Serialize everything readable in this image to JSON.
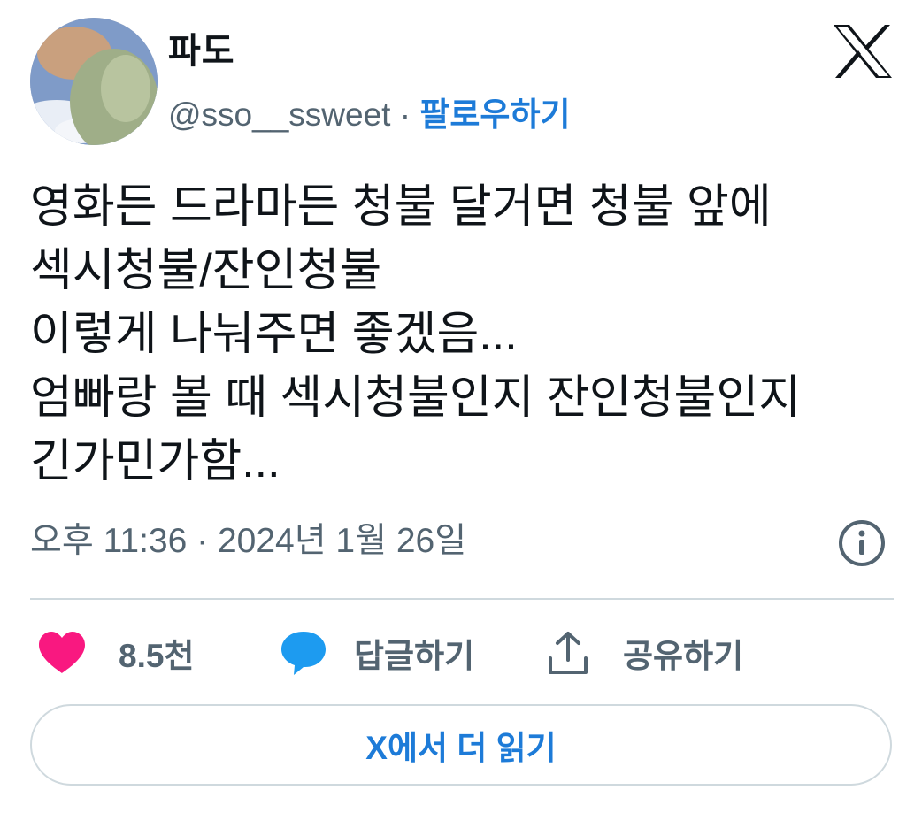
{
  "author": {
    "display_name": "파도",
    "handle": "@sso__ssweet",
    "separator": "·",
    "follow_label": "팔로우하기"
  },
  "tweet": {
    "lines": [
      "영화든 드라마든 청불 달거면 청불 앞에",
      "섹시청불/잔인청불",
      "이렇게 나눠주면 좋겠음...",
      "엄빠랑 볼 때 섹시청불인지 잔인청불인지",
      "긴가민가함..."
    ],
    "timestamp": "오후 11:36 · 2024년 1월 26일"
  },
  "actions": {
    "like_count": "8.5천",
    "reply_label": "답글하기",
    "share_label": "공유하기"
  },
  "read_more_label": "X에서 더 읽기",
  "colors": {
    "like": "#f91880",
    "reply": "#1d9bf0",
    "link": "#1d7bd8",
    "muted": "#536471"
  },
  "icons": {
    "brand": "x-logo-icon",
    "info": "info-icon",
    "like": "heart-icon",
    "reply": "speech-bubble-icon",
    "share": "share-upload-icon"
  }
}
